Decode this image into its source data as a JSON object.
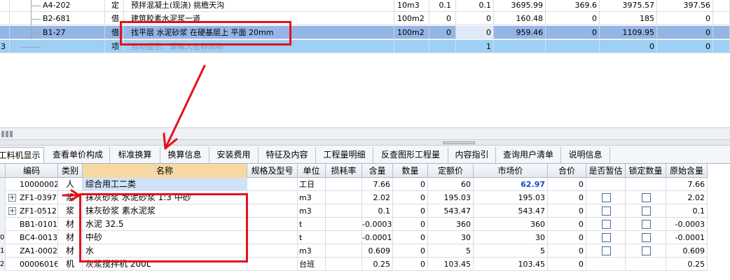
{
  "top_rows": [
    {
      "idx": "",
      "code": "A4-202",
      "type": "定",
      "name": "预拌混凝土(现浇) 挑檐天沟",
      "unit": "10m3",
      "qty": "0.1",
      "qty2": "0.1",
      "p1": "3695.99",
      "p2": "369.6",
      "p3": "3975.57",
      "p4": "397.56"
    },
    {
      "idx": "",
      "code": "B2-681",
      "type": "借",
      "name": "建筑胶素水泥浆一道",
      "unit": "100m2",
      "qty": "0",
      "qty2": "0",
      "p1": "160.48",
      "p2": "0",
      "p3": "185",
      "p4": "0"
    },
    {
      "idx": "",
      "code": "B1-27",
      "type": "借",
      "name": "找平层 水泥砂浆 在硬基层上 平面 20mm",
      "unit": "100m2",
      "qty": "0",
      "qty2": "0",
      "p1": "959.46",
      "p2": "0",
      "p3": "1109.95",
      "p4": "0"
    },
    {
      "idx": "3",
      "code": "",
      "type": "项",
      "name": "自动提示：请输入名称简称",
      "unit": "",
      "qty": "",
      "qty2": "1",
      "p1": "",
      "p2": "",
      "p3": "0",
      "p4": "0"
    }
  ],
  "tabs": [
    "工料机显示",
    "查看单价构成",
    "标准换算",
    "换算信息",
    "安装费用",
    "特征及内容",
    "工程量明细",
    "反查图形工程量",
    "内容指引",
    "查询用户清单",
    "说明信息"
  ],
  "columns": [
    "编码",
    "类别",
    "名称",
    "规格及型号",
    "单位",
    "损耗率",
    "含量",
    "数量",
    "定额价",
    "市场价",
    "合价",
    "是否暂估",
    "锁定数量",
    "原始含量"
  ],
  "rows": [
    {
      "idx": "",
      "code": "10000002",
      "type": "人",
      "name": "综合用工二类",
      "spec": "",
      "unit": "工日",
      "loss": "",
      "qty": "7.66",
      "num": "0",
      "dprice": "60",
      "mprice": "62.97",
      "total": "0",
      "checks": false,
      "orig": "7.66",
      "expand": false
    },
    {
      "idx": "",
      "code": "ZF1-0397",
      "type": "浆",
      "name": "抹灰砂浆 水泥砂浆 1:3 中砂",
      "spec": "",
      "unit": "m3",
      "loss": "",
      "qty": "2.02",
      "num": "0",
      "dprice": "195.03",
      "mprice": "195.03",
      "total": "0",
      "checks": true,
      "orig": "2.02",
      "expand": true
    },
    {
      "idx": "",
      "code": "ZF1-0512",
      "type": "浆",
      "name": "抹灰砂浆 素水泥浆",
      "spec": "",
      "unit": "m3",
      "loss": "",
      "qty": "0.1",
      "num": "0",
      "dprice": "543.47",
      "mprice": "543.47",
      "total": "0",
      "checks": true,
      "orig": "0.1",
      "expand": true
    },
    {
      "idx": "",
      "code": "BB1-0101",
      "type": "材",
      "name": "水泥 32.5",
      "spec": "",
      "unit": "t",
      "loss": "",
      "qty": "-0.0003",
      "num": "0",
      "dprice": "360",
      "mprice": "360",
      "total": "0",
      "checks": true,
      "orig": "-0.0003",
      "expand": false
    },
    {
      "idx": "0",
      "code": "BC4-0013",
      "type": "材",
      "name": "中砂",
      "spec": "",
      "unit": "t",
      "loss": "",
      "qty": "-0.0001",
      "num": "0",
      "dprice": "30",
      "mprice": "30",
      "total": "0",
      "checks": true,
      "orig": "-0.0001",
      "expand": false
    },
    {
      "idx": "1",
      "code": "ZA1-0002",
      "type": "材",
      "name": "水",
      "spec": "",
      "unit": "m3",
      "loss": "",
      "qty": "0.609",
      "num": "0",
      "dprice": "5",
      "mprice": "5",
      "total": "0",
      "checks": true,
      "orig": "0.609",
      "expand": false
    },
    {
      "idx": "2",
      "code": "00006016",
      "type": "机",
      "name": "灰浆搅拌机 200L",
      "spec": "",
      "unit": "台班",
      "loss": "",
      "qty": "0.25",
      "num": "0",
      "dprice": "103.45",
      "mprice": "103.45",
      "total": "0",
      "checks": false,
      "orig": "0.25",
      "expand": false
    }
  ],
  "colors": {
    "annotation": "#e4111b",
    "selected_row": "#94b5e6",
    "market_price": "#1a45c8"
  }
}
